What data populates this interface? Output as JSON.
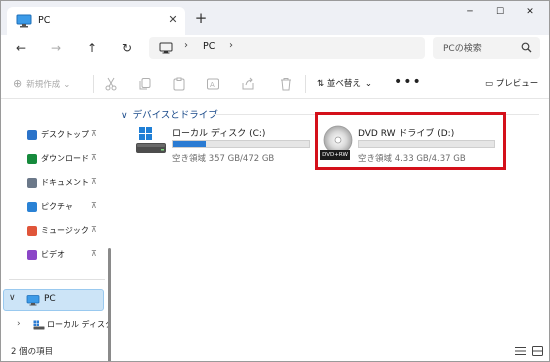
{
  "tab": {
    "title": "PC",
    "close_glyph": "✕",
    "new_tab_glyph": "+"
  },
  "window_controls": {
    "minimize": "─",
    "maximize": "☐",
    "close": "✕"
  },
  "nav": {
    "back": "←",
    "forward": "→",
    "up": "↑",
    "refresh": "↻"
  },
  "address": {
    "path": "PC",
    "chevron": "›",
    "computer_chevron": "›"
  },
  "search": {
    "placeholder": "PCの検索"
  },
  "commandbar": {
    "new_label": "新規作成",
    "sort_label": "並べ替え",
    "more_label": "•••",
    "preview_label": "プレビュー"
  },
  "sidebar": {
    "quick_access": [
      {
        "label": "デスクトップ",
        "icon": "desktop-icon",
        "color": "#2b73c9"
      },
      {
        "label": "ダウンロード",
        "icon": "download-icon",
        "color": "#168a3c"
      },
      {
        "label": "ドキュメント",
        "icon": "documents-icon",
        "color": "#6b7889"
      },
      {
        "label": "ピクチャ",
        "icon": "pictures-icon",
        "color": "#2a82d5"
      },
      {
        "label": "ミュージック",
        "icon": "music-icon",
        "color": "#e0553a"
      },
      {
        "label": "ビデオ",
        "icon": "videos-icon",
        "color": "#8b46c7"
      }
    ],
    "pin_glyph": "📌",
    "pc_label": "PC",
    "pc_toggle": "∨",
    "local_label": "ローカル ディスク",
    "local_toggle": "›"
  },
  "main": {
    "group_title": "デバイスとドライブ",
    "group_chevron": "∨",
    "drives": [
      {
        "name": "ローカル ディスク (C:)",
        "free_text": "空き領域 357 GB/472 GB",
        "used_fraction": 0.24,
        "icon": "local-disk-icon"
      },
      {
        "name": "DVD RW ドライブ (D:)",
        "free_text": "空き領域 4.33 GB/4.37 GB",
        "used_fraction": 0.0,
        "icon": "dvd-rw-icon",
        "icon_caption": "DVD+RW"
      }
    ]
  },
  "status": {
    "item_count": "2 個の項目"
  },
  "colors": {
    "accent": "#2a7bd3",
    "highlight": "#d4101a",
    "selection": "#cce4f7"
  }
}
